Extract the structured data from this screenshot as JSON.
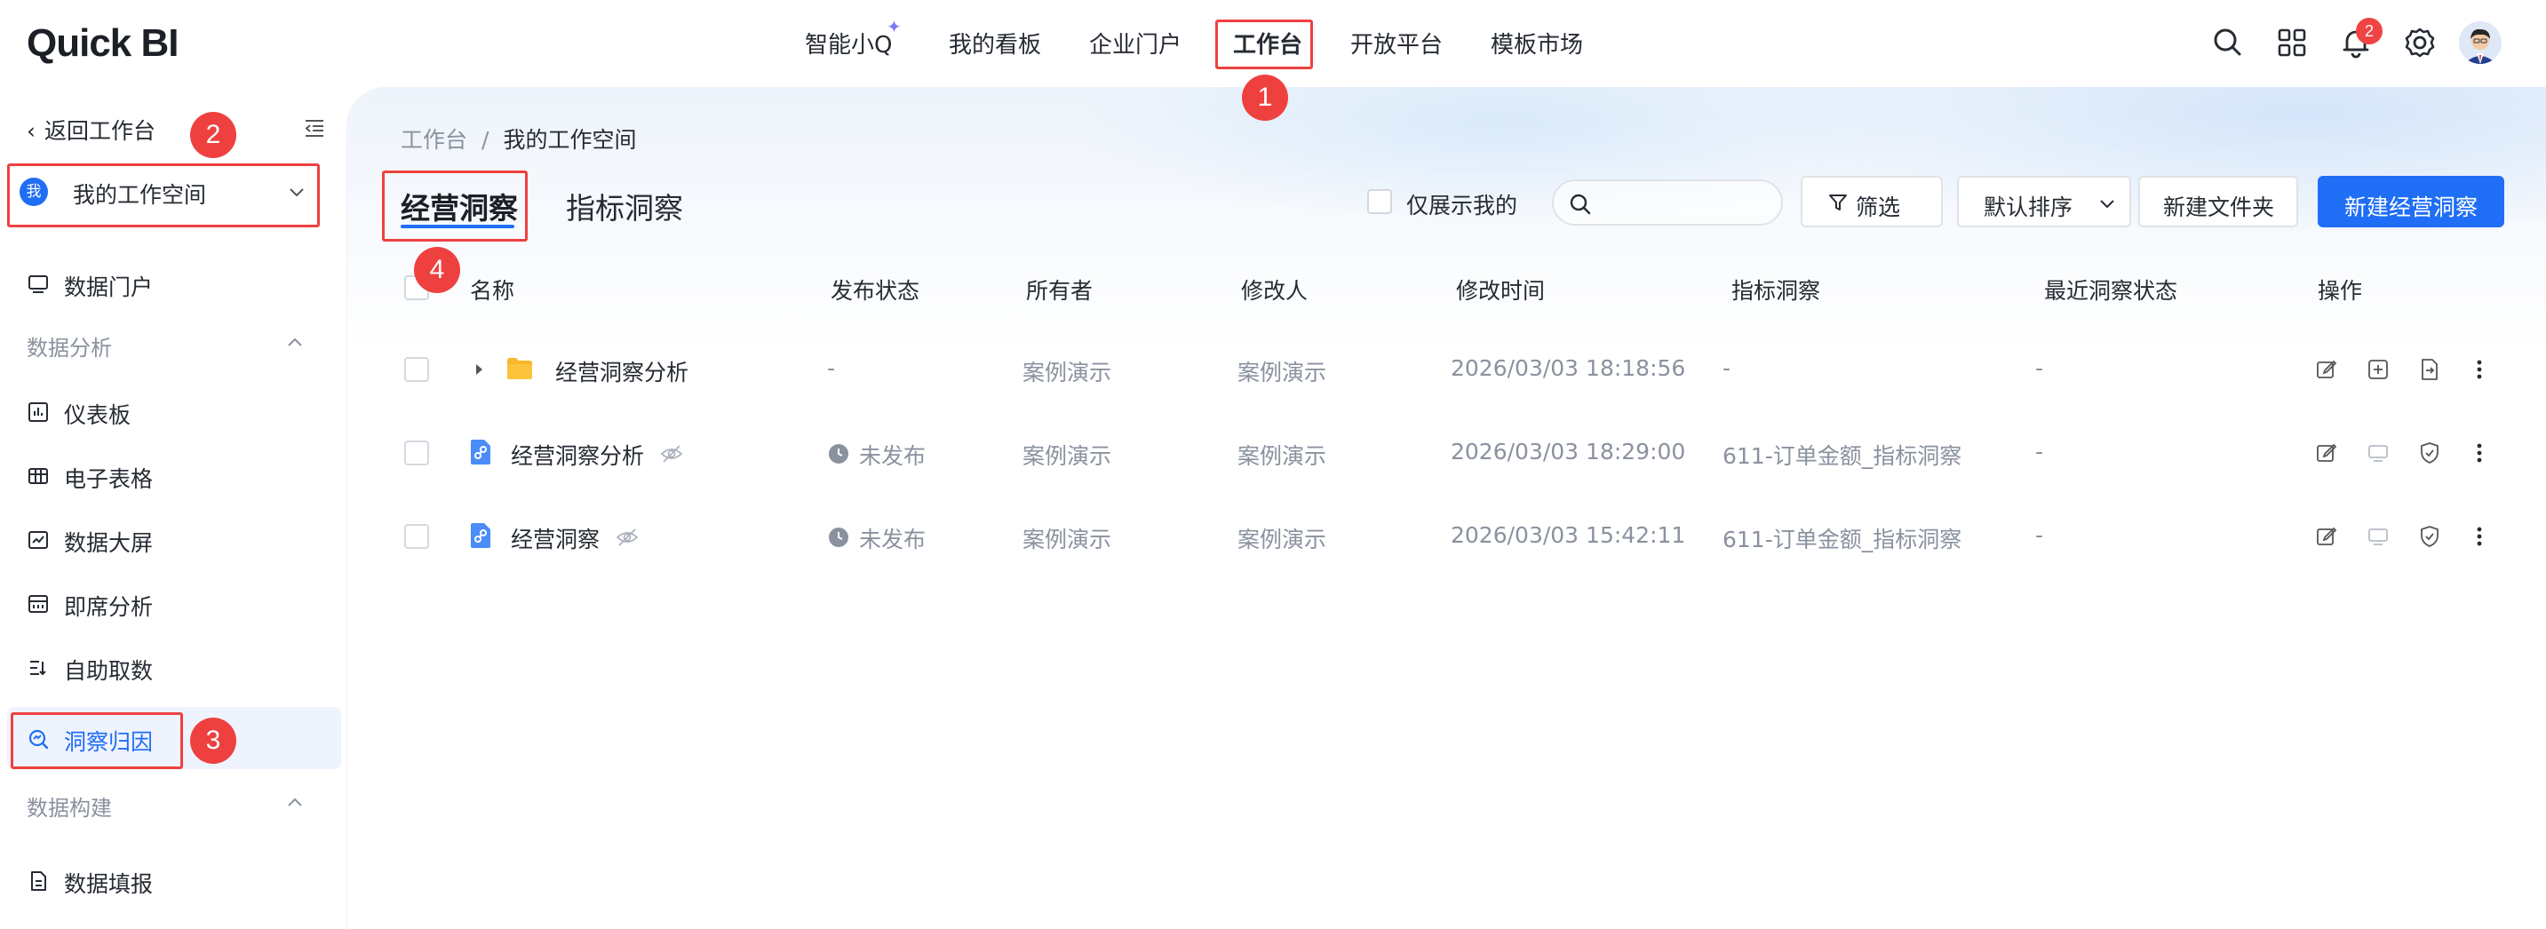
{
  "app": {
    "logo": "Quick BI"
  },
  "topnav": {
    "items": [
      {
        "label": "智能小Q"
      },
      {
        "label": "我的看板"
      },
      {
        "label": "企业门户"
      },
      {
        "label": "工作台"
      },
      {
        "label": "开放平台"
      },
      {
        "label": "模板市场"
      }
    ],
    "notification_count": "2",
    "icons": [
      "search-icon",
      "apps-grid-icon",
      "bell-icon",
      "gear-icon",
      "user-avatar"
    ]
  },
  "sidebar": {
    "back_label": "返回工作台",
    "workspace": {
      "badge": "我",
      "label": "我的工作空间"
    },
    "portal": "数据门户",
    "groups": [
      {
        "title": "数据分析",
        "items": [
          "仪表板",
          "电子表格",
          "数据大屏",
          "即席分析",
          "自助取数",
          "洞察归因"
        ]
      },
      {
        "title": "数据构建",
        "items": [
          "数据填报"
        ]
      }
    ],
    "active_item": "洞察归因"
  },
  "main": {
    "breadcrumb": [
      "工作台",
      "我的工作空间"
    ],
    "breadcrumb_sep": "/",
    "tabs": [
      "经营洞察",
      "指标洞察"
    ],
    "active_tab": "经营洞察",
    "only_mine_label": "仅展示我的",
    "search_placeholder": "",
    "filter_label": "筛选",
    "sort_label": "默认排序",
    "new_folder_label": "新建文件夹",
    "new_insight_label": "新建经营洞察"
  },
  "table": {
    "columns": [
      "名称",
      "发布状态",
      "所有者",
      "修改人",
      "修改时间",
      "指标洞察",
      "最近洞察状态",
      "操作"
    ],
    "rows": [
      {
        "type": "folder",
        "name": "经营洞察分析",
        "publish_status": "-",
        "owner": "案例演示",
        "modifier": "案例演示",
        "modified_time": "2026/03/03 18:18:56",
        "metric_insight": "-",
        "last_status": "-"
      },
      {
        "type": "insight",
        "name": "经营洞察分析",
        "publish_status": "未发布",
        "owner": "案例演示",
        "modifier": "案例演示",
        "modified_time": "2026/03/03 18:29:00",
        "metric_insight": "611-订单金额_指标洞察",
        "last_status": "-"
      },
      {
        "type": "insight",
        "name": "经营洞察",
        "publish_status": "未发布",
        "owner": "案例演示",
        "modifier": "案例演示",
        "modified_time": "2026/03/03 15:42:11",
        "metric_insight": "611-订单金额_指标洞察",
        "last_status": "-"
      }
    ]
  },
  "annotations": [
    "1",
    "2",
    "3",
    "4"
  ],
  "colors": {
    "accent": "#1f6ef5",
    "annotation": "#ef4040",
    "folder": "#f7b82b"
  }
}
